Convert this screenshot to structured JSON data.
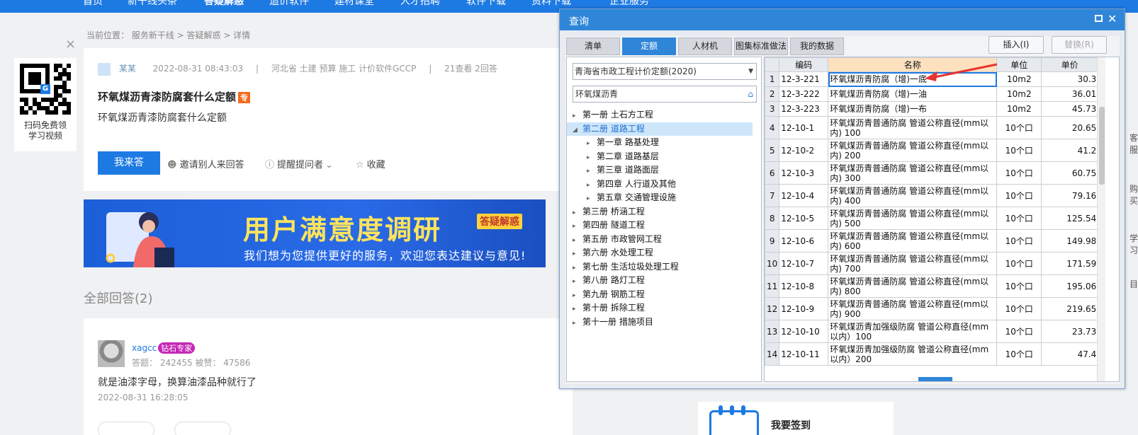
{
  "nav": {
    "items": [
      "首页",
      "新干线头条",
      "答疑解惑",
      "造价软件",
      "建材课堂",
      "人才招聘",
      "软件下载",
      "资料下载",
      "企业服务"
    ]
  },
  "breadcrumb": "当前位置： 服务新干线 > 答疑解惑 > 详情",
  "qr": {
    "logo": "G",
    "text_line1": "扫码免费领",
    "text_line2": "学习视频",
    "close": "×"
  },
  "question": {
    "author": "某某",
    "date": "2022-08-31 08:43:03",
    "sep": "|",
    "region_tags": "河北省  土建 预算 施工 计价软件GCCP",
    "views": "21查看  2回答",
    "title": "环氧煤沥青漆防腐套什么定额",
    "tag": "专",
    "body": "环氧煤沥青漆防腐套什么定额",
    "answer_button": "我来答",
    "invite": "邀请别人来回答",
    "remind": "提醒提问者",
    "favorite": "收藏"
  },
  "banner": {
    "title": "用户满意度调研",
    "tag": "答疑解惑",
    "subtitle": "我们想为您提供更好的服务，欢迎您表达建议与意见!"
  },
  "answers_heading": "全部回答(2)",
  "answer": {
    "user": "xagcc",
    "badge": "钻石专家",
    "stats": "答题： 242455    被赞： 47586",
    "text": "就是油漆字母，换算油漆品种就行了",
    "time": "2022-08-31 16:28:05"
  },
  "sign": {
    "label": "我要签到"
  },
  "side": [
    "客服",
    "购买",
    "学习",
    "目"
  ],
  "dialog": {
    "title": "查询",
    "close": "✕",
    "tabs": [
      "清单",
      "定额",
      "人材机",
      "图集标准做法",
      "我的数据"
    ],
    "active_tab": "定额",
    "insert_button": "插入(I)",
    "replace_button": "替换(R)",
    "quota_select": "青海省市政工程计价定额(2020)",
    "search_value": "环氧煤沥青",
    "tree": [
      {
        "label": "第一册 土石方工程",
        "level": 0,
        "expanded": false
      },
      {
        "label": "第二册 道路工程",
        "level": 0,
        "expanded": true,
        "selected": true
      },
      {
        "label": "第一章 路基处理",
        "level": 1,
        "expanded": false
      },
      {
        "label": "第二章 道路基层",
        "level": 1,
        "expanded": false
      },
      {
        "label": "第三章 道路面层",
        "level": 1,
        "expanded": false
      },
      {
        "label": "第四章 人行道及其他",
        "level": 1,
        "expanded": false
      },
      {
        "label": "第五章 交通管理设施",
        "level": 1,
        "expanded": false
      },
      {
        "label": "第三册 桥涵工程",
        "level": 0,
        "expanded": false
      },
      {
        "label": "第四册 隧道工程",
        "level": 0,
        "expanded": false
      },
      {
        "label": "第五册 市政管网工程",
        "level": 0,
        "expanded": false
      },
      {
        "label": "第六册 水处理工程",
        "level": 0,
        "expanded": false
      },
      {
        "label": "第七册 生活垃圾处理工程",
        "level": 0,
        "expanded": false
      },
      {
        "label": "第八册 路灯工程",
        "level": 0,
        "expanded": false
      },
      {
        "label": "第九册 钢筋工程",
        "level": 0,
        "expanded": false
      },
      {
        "label": "第十册 拆除工程",
        "level": 0,
        "expanded": false
      },
      {
        "label": "第十一册 措施项目",
        "level": 0,
        "expanded": false
      }
    ],
    "columns": [
      "编码",
      "名称",
      "单位",
      "单价"
    ],
    "rows": [
      {
        "n": "1",
        "code": "12-3-221",
        "name": "环氧煤沥青防腐（增)一底",
        "unit": "10m2",
        "price": "30.3"
      },
      {
        "n": "2",
        "code": "12-3-222",
        "name": "环氧煤沥青防腐（增)一油",
        "unit": "10m2",
        "price": "36.01"
      },
      {
        "n": "3",
        "code": "12-3-223",
        "name": "环氧煤沥青防腐（增)一布",
        "unit": "10m2",
        "price": "45.73"
      },
      {
        "n": "4",
        "code": "12-10-1",
        "name": "环氧煤沥青普通防腐 管道公称直径(mm以内) 100",
        "unit": "10个口",
        "price": "20.65"
      },
      {
        "n": "5",
        "code": "12-10-2",
        "name": "环氧煤沥青普通防腐 管道公称直径(mm以内) 200",
        "unit": "10个口",
        "price": "41.2"
      },
      {
        "n": "6",
        "code": "12-10-3",
        "name": "环氧煤沥青普通防腐 管道公称直径(mm以内) 300",
        "unit": "10个口",
        "price": "60.75"
      },
      {
        "n": "7",
        "code": "12-10-4",
        "name": "环氧煤沥青普通防腐 管道公称直径(mm以内) 400",
        "unit": "10个口",
        "price": "79.16"
      },
      {
        "n": "8",
        "code": "12-10-5",
        "name": "环氧煤沥青普通防腐 管道公称直径(mm以内) 500",
        "unit": "10个口",
        "price": "125.54"
      },
      {
        "n": "9",
        "code": "12-10-6",
        "name": "环氧煤沥青普通防腐 管道公称直径(mm以内) 600",
        "unit": "10个口",
        "price": "149.98"
      },
      {
        "n": "10",
        "code": "12-10-7",
        "name": "环氧煤沥青普通防腐 管道公称直径(mm以内) 700",
        "unit": "10个口",
        "price": "171.59"
      },
      {
        "n": "11",
        "code": "12-10-8",
        "name": "环氧煤沥青普通防腐 管道公称直径(mm以内) 800",
        "unit": "10个口",
        "price": "195.06"
      },
      {
        "n": "12",
        "code": "12-10-9",
        "name": "环氧煤沥青普通防腐 管道公称直径(mm以内) 900",
        "unit": "10个口",
        "price": "219.65"
      },
      {
        "n": "13",
        "code": "12-10-10",
        "name": "环氧煤沥青加强级防腐 管道公称直径(mm以内）100",
        "unit": "10个口",
        "price": "23.73"
      },
      {
        "n": "14",
        "code": "12-10-11",
        "name": "环氧煤沥青加强级防腐 管道公称直径(mm以内）200",
        "unit": "10个口",
        "price": "47.4"
      }
    ]
  },
  "colors": {
    "brand_blue": "#1e7ae3",
    "dialog_blue": "#2f86d8",
    "banner_yellow": "#ffe45c",
    "arrow_red": "#e8332e"
  }
}
